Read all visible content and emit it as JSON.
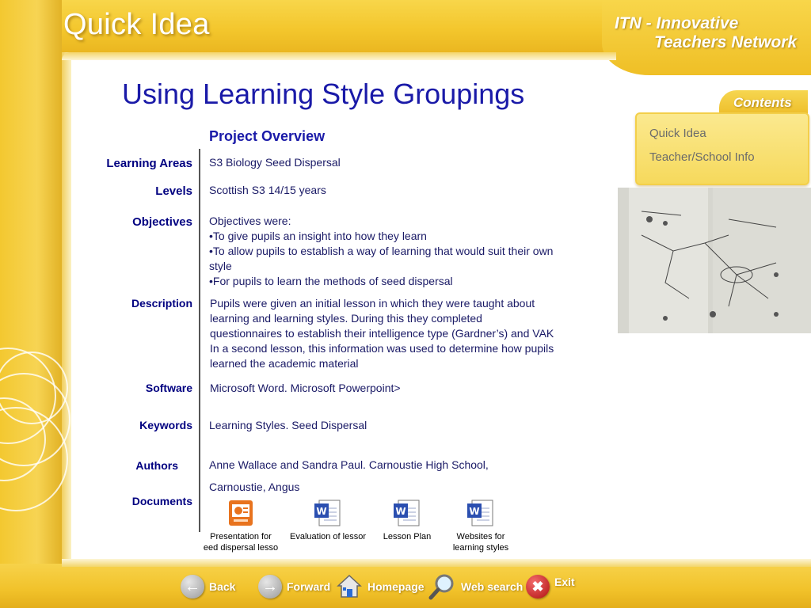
{
  "brand": {
    "title": "Quick Idea",
    "itn_line1": "ITN - Innovative",
    "itn_line2": "Teachers Network"
  },
  "page_title": "Using Learning Style Groupings",
  "section_title": "Project Overview",
  "contents": {
    "tab_label": "Contents",
    "links": [
      "Quick Idea",
      "Teacher/School Info"
    ]
  },
  "overview": {
    "learning_areas": {
      "label": "Learning Areas",
      "value": "S3 Biology Seed Dispersal"
    },
    "levels": {
      "label": "Levels",
      "value": "Scottish S3 14/15 years"
    },
    "objectives": {
      "label": "Objectives",
      "lines": [
        "Objectives were:",
        "•To give pupils an insight into how they learn",
        "•To allow pupils to establish a way of learning that would suit their own",
        "style",
        "•For pupils to learn the methods of seed dispersal"
      ]
    },
    "description": {
      "label": "Description",
      "lines": [
        "Pupils were given an initial lesson in which they were taught about",
        "learning and learning styles.  During this they completed",
        "questionnaires to establish their intelligence type (Gardner’s) and VAK",
        "In a second lesson, this information was used to determine how pupils",
        "learned the academic material"
      ]
    },
    "software": {
      "label": "Software",
      "value": "Microsoft Word. Microsoft Powerpoint>"
    },
    "keywords": {
      "label": "Keywords",
      "value": "Learning Styles. Seed Dispersal"
    },
    "authors": {
      "label": "Authors",
      "line1": "Anne Wallace and Sandra Paul.  Carnoustie High School,",
      "line2": "Carnoustie, Angus"
    },
    "documents": {
      "label": "Documents",
      "items": [
        {
          "caption1": "Presentation for",
          "caption2": "eed dispersal lesso",
          "type": "powerpoint"
        },
        {
          "caption1": "Evaluation of lessor",
          "caption2": "",
          "type": "word"
        },
        {
          "caption1": "Lesson Plan",
          "caption2": "",
          "type": "word"
        },
        {
          "caption1": "Websites for",
          "caption2": "learning styles",
          "type": "word"
        }
      ]
    }
  },
  "nav": {
    "back": "Back",
    "forward": "Forward",
    "homepage": "Homepage",
    "web_search": "Web search",
    "exit": "Exit"
  },
  "colors": {
    "frame": "#f3c62c",
    "title_blue": "#1a1aa8",
    "label_navy": "#000080"
  }
}
